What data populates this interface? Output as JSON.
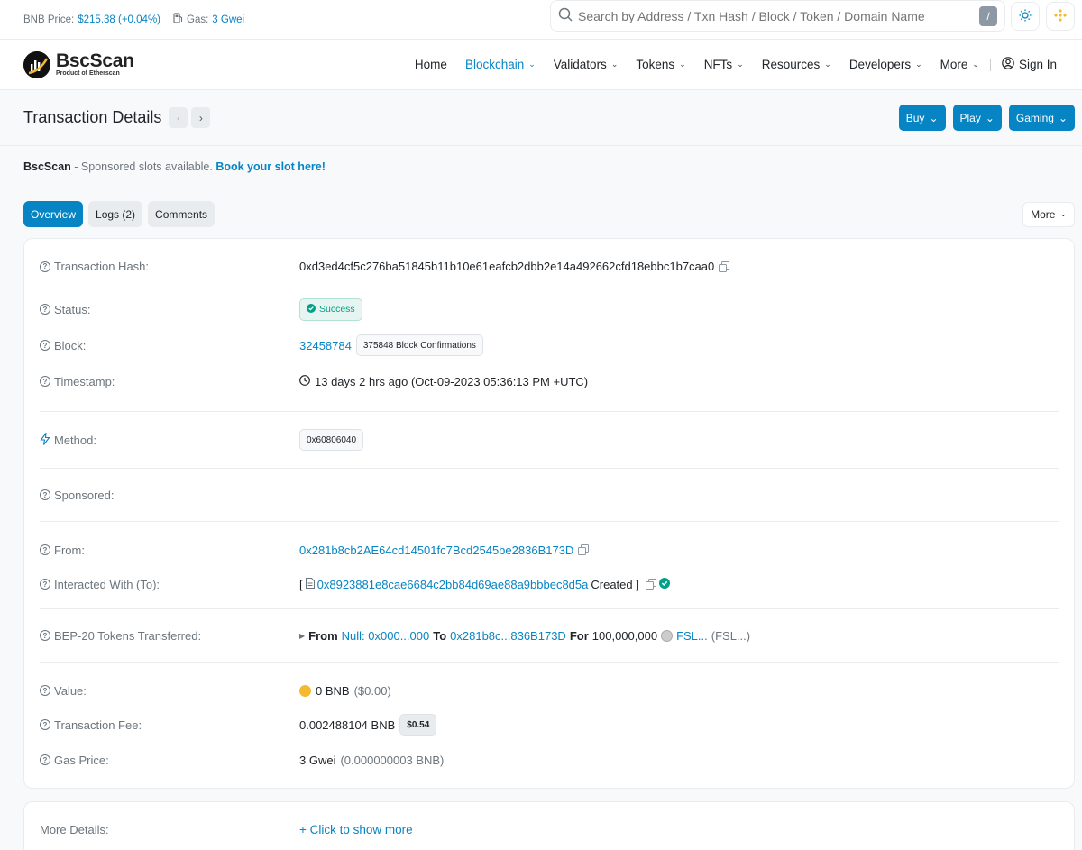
{
  "topbar": {
    "bnb_price_label": "BNB Price:",
    "bnb_price_value": "$215.38 (+0.04%)",
    "gas_label": "Gas:",
    "gas_value": "3 Gwei",
    "search_placeholder": "Search by Address / Txn Hash / Block / Token / Domain Name",
    "search_shortcut": "/"
  },
  "brand": {
    "name": "BscScan",
    "tagline": "Product of Etherscan"
  },
  "nav": {
    "items": [
      {
        "label": "Home",
        "dropdown": false,
        "active": false
      },
      {
        "label": "Blockchain",
        "dropdown": true,
        "active": true
      },
      {
        "label": "Validators",
        "dropdown": true,
        "active": false
      },
      {
        "label": "Tokens",
        "dropdown": true,
        "active": false
      },
      {
        "label": "NFTs",
        "dropdown": true,
        "active": false
      },
      {
        "label": "Resources",
        "dropdown": true,
        "active": false
      },
      {
        "label": "Developers",
        "dropdown": true,
        "active": false
      },
      {
        "label": "More",
        "dropdown": true,
        "active": false
      }
    ],
    "signin": "Sign In"
  },
  "header": {
    "title": "Transaction Details",
    "buttons": [
      "Buy",
      "Play",
      "Gaming"
    ]
  },
  "sponsor": {
    "brand": "BscScan",
    "text": " - Sponsored slots available. ",
    "link": "Book your slot here!"
  },
  "tabs": {
    "items": [
      "Overview",
      "Logs (2)",
      "Comments"
    ],
    "active": "Overview",
    "more": "More"
  },
  "details": {
    "tx_hash_label": "Transaction Hash:",
    "tx_hash": "0xd3ed4cf5c276ba51845b11b10e61eafcb2dbb2e14a492662cfd18ebbc1b7caa0",
    "status_label": "Status:",
    "status": "Success",
    "block_label": "Block:",
    "block": "32458784",
    "confirmations": "375848 Block Confirmations",
    "timestamp_label": "Timestamp:",
    "timestamp": "13 days 2 hrs ago (Oct-09-2023 05:36:13 PM +UTC)",
    "method_label": "Method:",
    "method": "0x60806040",
    "sponsored_label": "Sponsored:",
    "from_label": "From:",
    "from": "0x281b8cb2AE64cd14501fc7Bcd2545be2836B173D",
    "to_label": "Interacted With (To):",
    "to_open": "[",
    "to_contract": "0x8923881e8cae6684c2bb84d69ae88a9bbbec8d5a",
    "to_created": "Created ]",
    "tokens_label": "BEP-20 Tokens Transferred:",
    "tokens_from_kw": "From",
    "tokens_from": "Null: 0x000...000",
    "tokens_to_kw": "To",
    "tokens_to": "0x281b8c...836B173D",
    "tokens_for_kw": "For",
    "tokens_amount": "100,000,000",
    "tokens_token": "FSL...",
    "tokens_symbol": "(FSL...)",
    "value_label": "Value:",
    "value": "0 BNB",
    "value_usd": "($0.00)",
    "fee_label": "Transaction Fee:",
    "fee": "0.002488104 BNB",
    "fee_usd": "$0.54",
    "gas_price_label": "Gas Price:",
    "gas_price": "3 Gwei",
    "gas_price_bnb": "(0.000000003 BNB)"
  },
  "more_details": {
    "label": "More Details:",
    "link": "+ Click to show more"
  },
  "colors": {
    "accent": "#0784c3",
    "success": "#00a186",
    "bnb": "#f3ba2f"
  }
}
